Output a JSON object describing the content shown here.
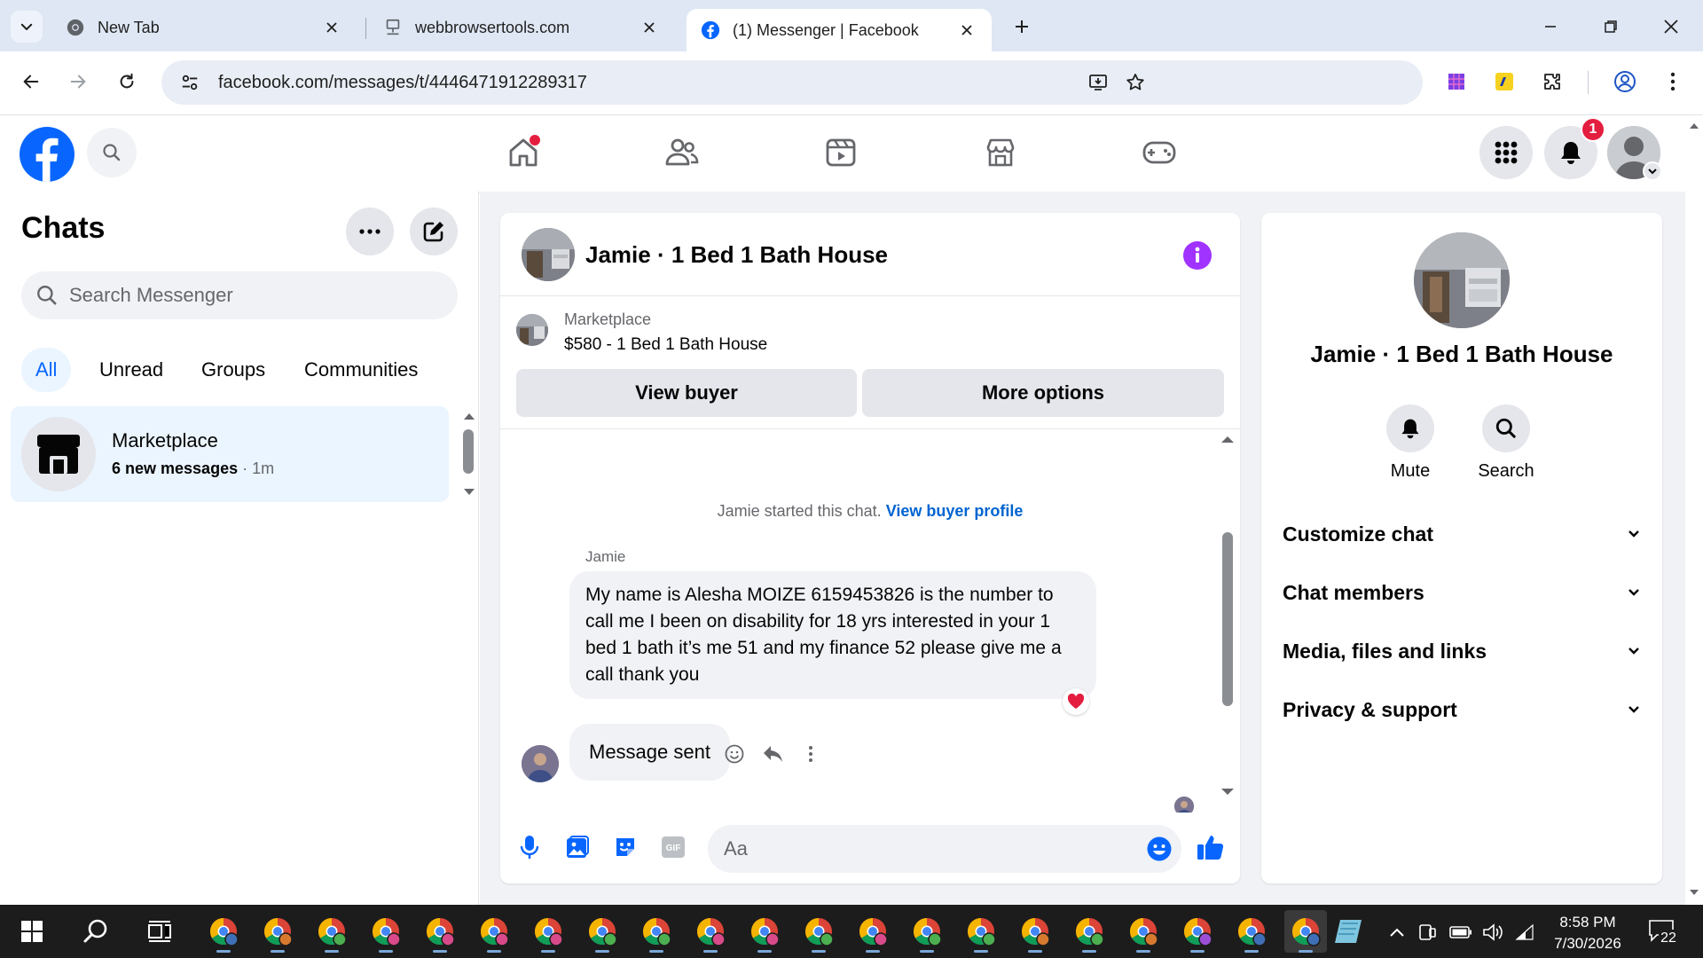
{
  "browser": {
    "tabs": [
      {
        "title": "New Tab",
        "icon": "chrome-icon",
        "active": false
      },
      {
        "title": "webbrowsertools.com",
        "icon": "site-icon",
        "active": false
      },
      {
        "title": "(1) Messenger | Facebook",
        "icon": "facebook-icon",
        "active": true
      }
    ],
    "url": "facebook.com/messages/t/4446471912289317"
  },
  "header": {
    "notification_count": "1"
  },
  "chats": {
    "title": "Chats",
    "search_placeholder": "Search Messenger",
    "filters": [
      "All",
      "Unread",
      "Groups",
      "Communities"
    ],
    "active_filter": "All",
    "items": [
      {
        "name": "Marketplace",
        "preview_bold": "6 new messages",
        "separator": " · ",
        "time": "1m"
      }
    ]
  },
  "conversation": {
    "title": "Jamie · 1 Bed 1 Bath House",
    "marketplace_label": "Marketplace",
    "listing": "$580 - 1 Bed 1 Bath House",
    "view_buyer": "View buyer",
    "more_options": "More options",
    "system_message": "Jamie started this chat.",
    "system_link": "View buyer profile",
    "sender": "Jamie",
    "incoming_message": "My name is Alesha MOIZE 6159453826 is the number to call me I been on disability for 18 yrs interested in your 1 bed 1 bath it’s me 51 and my finance 52 please give me a call thank you",
    "reaction": "heart",
    "outgoing_message": "Message sent",
    "composer_placeholder": "Aa"
  },
  "info_panel": {
    "name": "Jamie · 1 Bed 1 Bath House",
    "actions": [
      "Mute",
      "Search"
    ],
    "sections": [
      "Customize chat",
      "Chat members",
      "Media, files and links",
      "Privacy & support"
    ]
  },
  "taskbar": {
    "time": "8:58 PM",
    "date": "7/30/2026",
    "notifications": "22"
  },
  "colors": {
    "facebook_blue": "#0866ff",
    "messenger_purple": "#a033ff",
    "badge_red": "#e41e3f",
    "tab_strip": "#dfe7f4"
  }
}
